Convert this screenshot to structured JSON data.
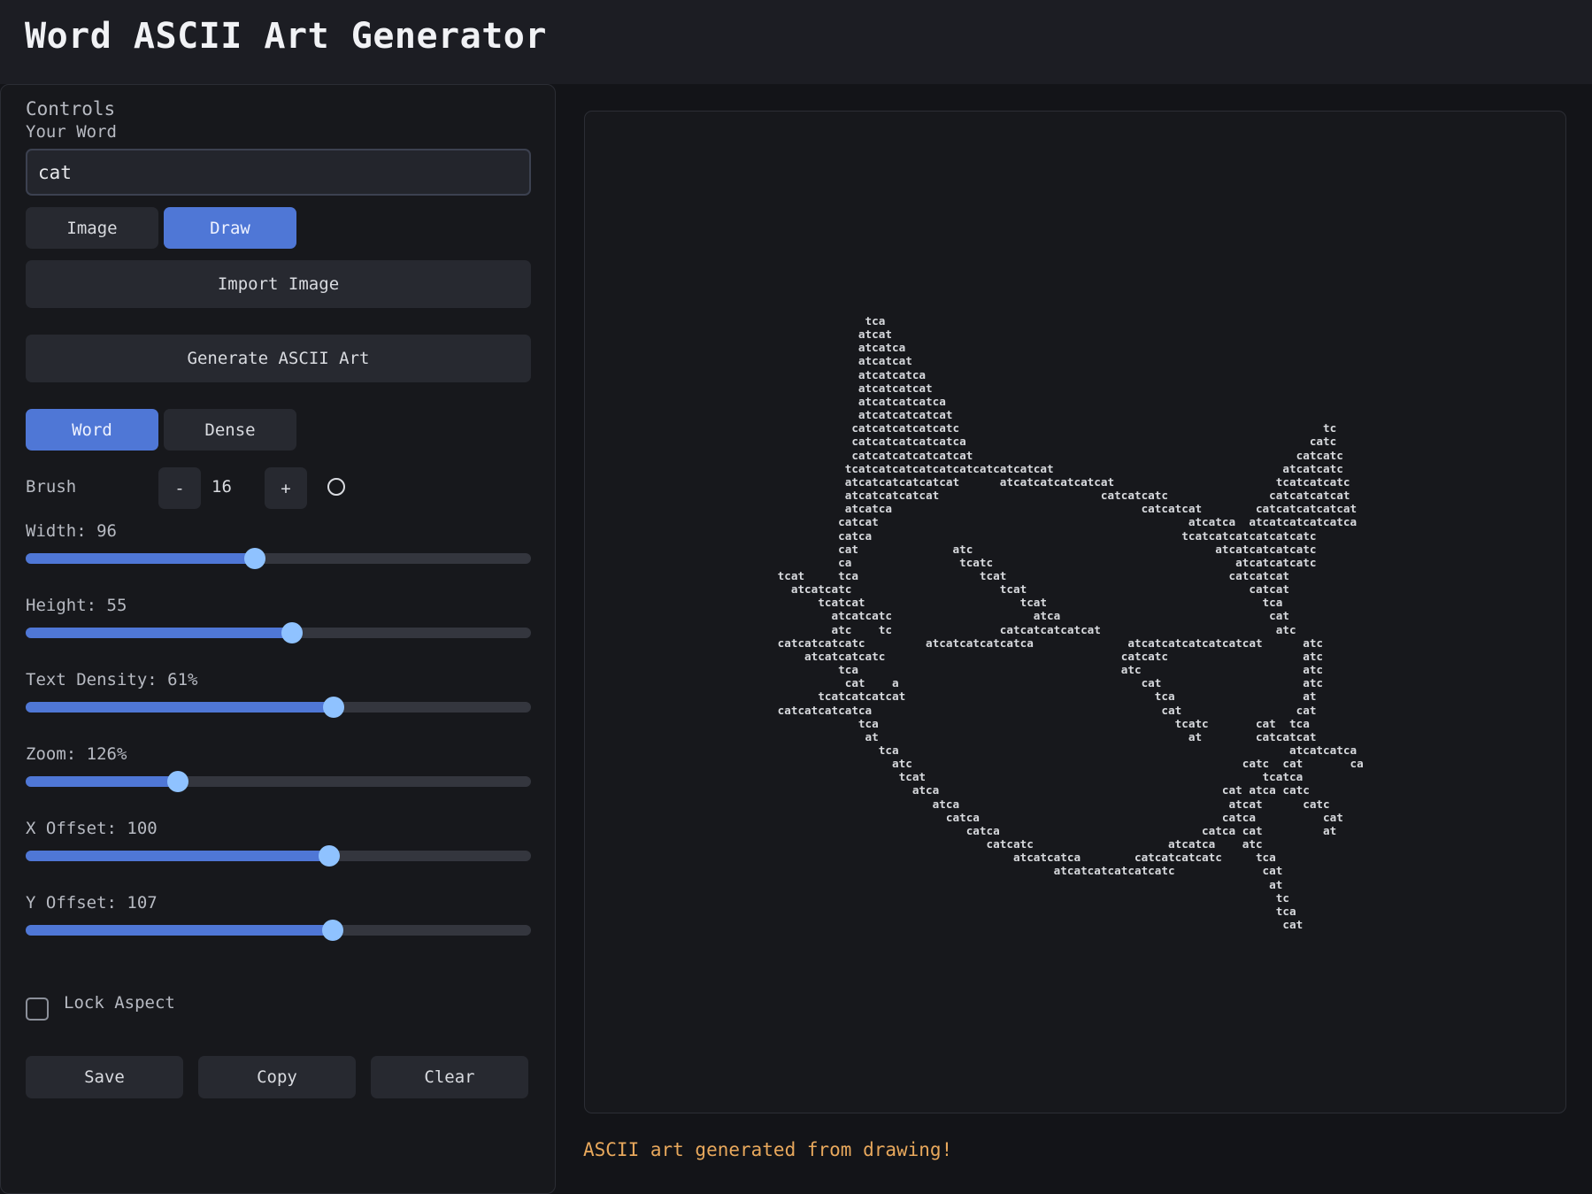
{
  "app": {
    "title": "Word ASCII Art Generator"
  },
  "controls": {
    "title": "Controls",
    "word_label": "Your Word",
    "word_value": "cat",
    "mode_tabs": [
      {
        "label": "Image",
        "active": false
      },
      {
        "label": "Draw",
        "active": true
      }
    ],
    "import_label": "Import Image",
    "generate_label": "Generate ASCII Art",
    "style_tabs": [
      {
        "label": "Word",
        "active": true
      },
      {
        "label": "Dense",
        "active": false
      }
    ],
    "brush": {
      "label": "Brush",
      "minus": "-",
      "value": "16",
      "plus": "+",
      "icon": "circle-outline-icon"
    },
    "sliders": {
      "width": {
        "label": "Width: 96",
        "fraction": 0.453
      },
      "height": {
        "label": "Height: 55",
        "fraction": 0.527
      },
      "density": {
        "label": "Text Density: 61%",
        "fraction": 0.61
      },
      "zoom": {
        "label": "Zoom: 126%",
        "fraction": 0.302
      },
      "x_offset": {
        "label": "X Offset: 100",
        "fraction": 0.6
      },
      "y_offset": {
        "label": "Y Offset: 107",
        "fraction": 0.607
      }
    },
    "lock_aspect": {
      "label": "Lock Aspect",
      "checked": false
    },
    "actions": {
      "save": "Save",
      "copy": "Copy",
      "clear": "Clear"
    }
  },
  "output": {
    "ascii": "              tca\n             atcat\n             atcatca\n             atcatcat\n             atcatcatca\n             atcatcatcat\n             atcatcatcatca\n             atcatcatcatcat\n            catcatcatcatcatc                                                      tc\n            catcatcatcatcatca                                                   catc\n            catcatcatcatcatcat                                                catcatc\n           tcatcatcatcatcatcatcatcatcatcat                                  atcatcatc\n           atcatcatcatcatcat      atcatcatcatcatcat                        tcatcatcatc\n           atcatcatcatcat                        catcatcatc               catcatcatcat\n           atcatca                                     catcatcat        catcatcatcatcat\n          catcat                                              atcatca  atcatcatcatcatca\n          catca                                              tcatcatcatcatcatcatc\n          cat              atc                                    atcatcatcatcatc\n          ca                tcatc                                    atcatcatcatc\n tcat     tca                  tcat                                 catcatcat\n   atcatcatc                      tcat                                 catcat\n       tcatcat                       tcat                                tca\n         atcatcatc                     atca                               cat\n         atc    tc                catcatcatcatcat                          atc\n catcatcatcatc         atcatcatcatcatca              atcatcatcatcatcatcat      atc\n     atcatcatcatc                                   catcatc                    atc\n          tca                                       atc                        atc\n           cat    a                                    cat                     atc\n       tcatcatcatcat                                     tca                   at\n catcatcatcatca                                           cat                 cat\n             tca                                            tcatc       cat  tca\n              at                                              at        catcatcat\n                tca                                                          atcatcatca\n                  atc                                                 catc  cat       ca\n                   tcat                                                  tcatca\n                     atca                                          cat atca catc\n                        atca                                        atcat      catc\n                          catca                                    catca          cat\n                             catca                              catca cat         at\n                                catcatc                    atcatca    atc\n                                    atcatcatca        catcatcatcatc     tca\n                                          atcatcatcatcatcatc             cat\n                                                                          at\n                                                                           tc\n                                                                           tca\n                                                                            cat",
    "status": "ASCII art generated from drawing!"
  }
}
